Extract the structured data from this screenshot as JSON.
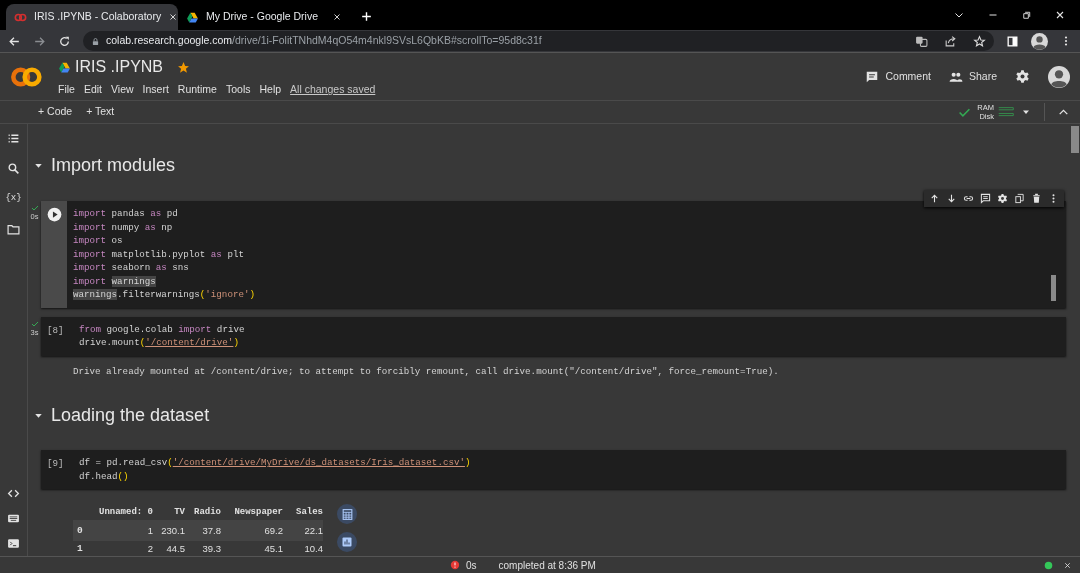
{
  "browser": {
    "tabs": [
      {
        "title": "IRIS .IPYNB - Colaboratory",
        "selected": true
      },
      {
        "title": "My Drive - Google Drive",
        "selected": false
      }
    ],
    "url": {
      "host": "colab.research.google.com",
      "path": "/drive/1i-FolitTNhdM4qO54m4nkl9SVsL6QbKB#scrollTo=95d8c31f"
    }
  },
  "notebook": {
    "title": "IRIS .IPYNB",
    "starred": true,
    "menu": [
      "File",
      "Edit",
      "View",
      "Insert",
      "Runtime",
      "Tools",
      "Help"
    ],
    "save_status": "All changes saved"
  },
  "header_actions": [
    {
      "kind": "comment",
      "label": "Comment"
    },
    {
      "kind": "share",
      "label": "Share"
    }
  ],
  "toolbar": {
    "add": [
      "+ Code",
      "+ Text"
    ],
    "connected": true,
    "resources": [
      "RAM",
      "Disk"
    ]
  },
  "sidebar": {
    "variables": "{x}"
  },
  "cells": [
    {
      "kind": "heading",
      "text": "Import modules",
      "expanded": true
    },
    {
      "kind": "code",
      "focused": true,
      "done": true,
      "time": "0s",
      "lines": [
        [
          {
            "kind": "keyword",
            "text": "import"
          },
          {
            "kind": "plain",
            "text": " pandas "
          },
          {
            "kind": "keyword",
            "text": "as"
          },
          {
            "kind": "plain",
            "text": " pd"
          }
        ],
        [
          {
            "kind": "keyword",
            "text": "import"
          },
          {
            "kind": "plain",
            "text": " numpy "
          },
          {
            "kind": "keyword",
            "text": "as"
          },
          {
            "kind": "plain",
            "text": " np"
          }
        ],
        [
          {
            "kind": "keyword",
            "text": "import"
          },
          {
            "kind": "plain",
            "text": " os"
          }
        ],
        [
          {
            "kind": "keyword",
            "text": "import"
          },
          {
            "kind": "plain",
            "text": " matplotlib.pyplot "
          },
          {
            "kind": "keyword",
            "text": "as"
          },
          {
            "kind": "plain",
            "text": " plt"
          }
        ],
        [
          {
            "kind": "keyword",
            "text": "import"
          },
          {
            "kind": "plain",
            "text": " seaborn "
          },
          {
            "kind": "keyword",
            "text": "as"
          },
          {
            "kind": "plain",
            "text": " sns"
          }
        ],
        [
          {
            "kind": "keyword",
            "text": "import "
          },
          {
            "kind": "selection",
            "text": "warnings"
          }
        ],
        [
          {
            "kind": "selection",
            "text": "warnings"
          },
          {
            "kind": "plain",
            "text": ".filterwarnings"
          },
          {
            "kind": "paren",
            "text": "("
          },
          {
            "kind": "string",
            "text": "'ignore'"
          },
          {
            "kind": "paren",
            "text": ")"
          }
        ]
      ]
    },
    {
      "kind": "code",
      "focused": false,
      "done": true,
      "count": "[8]",
      "time": "3s",
      "lines": [
        [
          {
            "kind": "keyword",
            "text": "from"
          },
          {
            "kind": "plain",
            "text": " google.colab "
          },
          {
            "kind": "keyword",
            "text": "import"
          },
          {
            "kind": "plain",
            "text": " drive"
          }
        ],
        [
          {
            "kind": "plain",
            "text": "drive.mount"
          },
          {
            "kind": "paren",
            "text": "("
          },
          {
            "kind": "path",
            "text": "'/content/drive'"
          },
          {
            "kind": "paren",
            "text": ")"
          }
        ]
      ],
      "output": "Drive already mounted at /content/drive; to attempt to forcibly remount, call drive.mount(\"/content/drive\", force_remount=True)."
    },
    {
      "kind": "heading",
      "text": "Loading the dataset",
      "expanded": true
    },
    {
      "kind": "code",
      "focused": false,
      "done": false,
      "count": "[9]",
      "lines": [
        [
          {
            "kind": "plain",
            "text": "df = pd.read_csv"
          },
          {
            "kind": "paren",
            "text": "("
          },
          {
            "kind": "path",
            "text": "'/content/drive/MyDrive/ds_datasets/Iris_dataset.csv'"
          },
          {
            "kind": "paren",
            "text": ")"
          }
        ],
        [
          {
            "kind": "plain",
            "text": "df.head"
          },
          {
            "kind": "paren",
            "text": "()"
          }
        ]
      ],
      "table": {
        "columns": [
          null,
          "Unnamed: 0",
          "TV",
          "Radio",
          "Newspaper",
          "Sales"
        ],
        "rows": [
          [
            "0",
            "1",
            "230.1",
            "37.8",
            "69.2",
            "22.1"
          ],
          [
            "1",
            "2",
            "44.5",
            "39.3",
            "45.1",
            "10.4"
          ]
        ]
      }
    }
  ],
  "status_bar": {
    "error": true,
    "time": "0s",
    "text": "completed at 8:36 PM",
    "connected": true
  }
}
